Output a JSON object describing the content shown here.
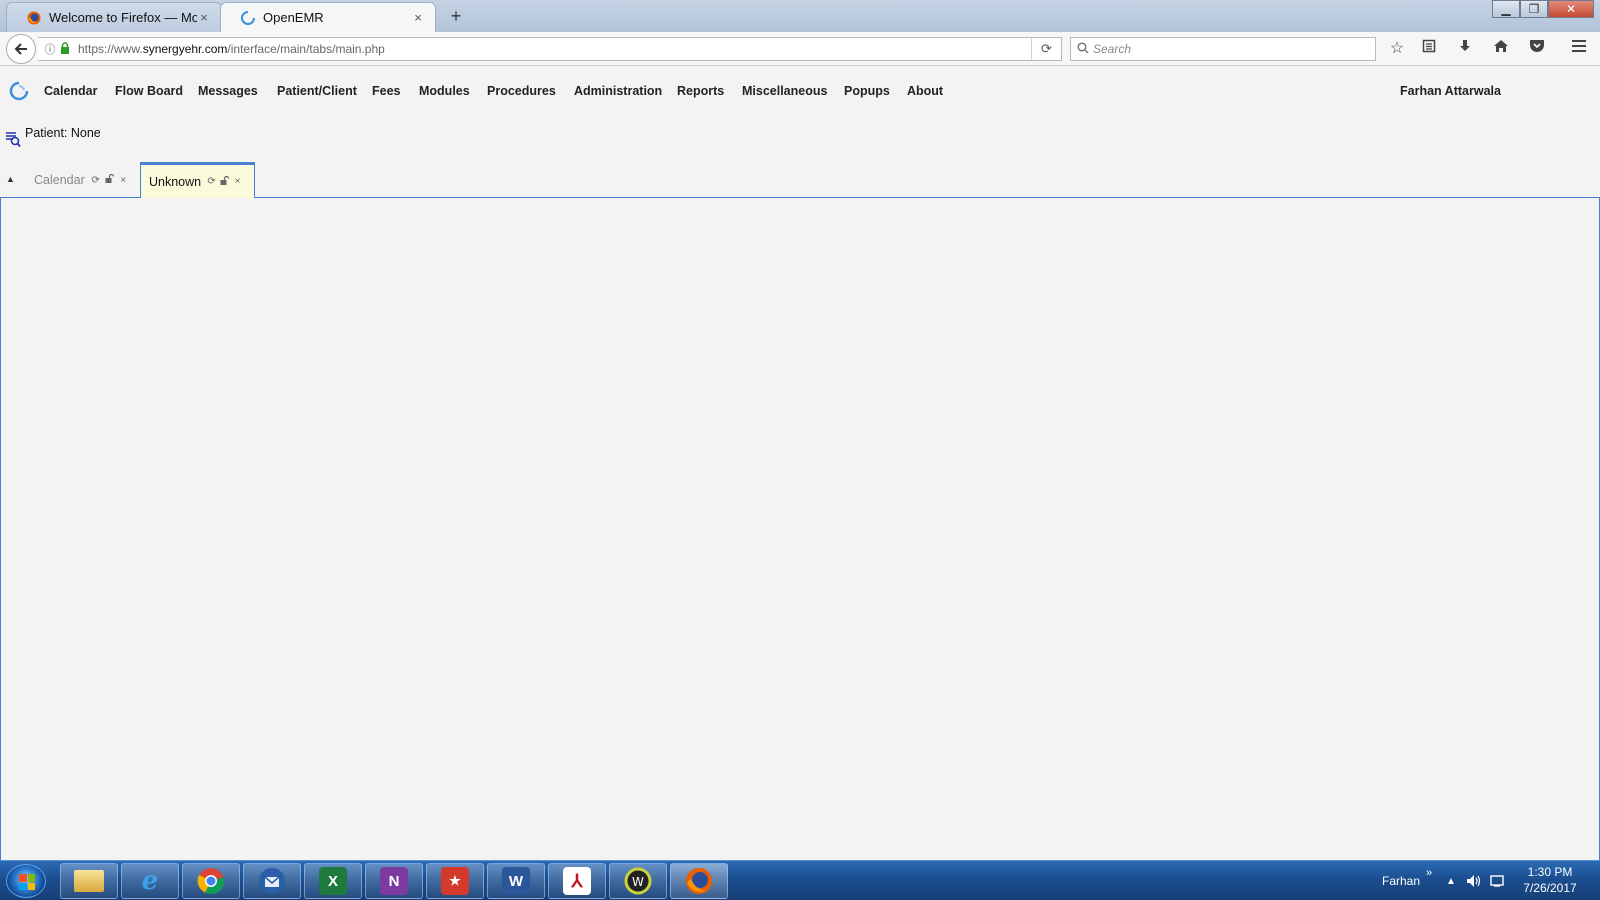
{
  "browser": {
    "tabs": [
      {
        "label": "Welcome to Firefox — Mozill",
        "active": false
      },
      {
        "label": "OpenEMR",
        "active": true
      }
    ],
    "new_tab": "+",
    "url": {
      "prefix": "https://www.",
      "host": "synergyehr.com",
      "path": "/interface/main/tabs/main.php"
    },
    "search_placeholder": "Search",
    "close_glyph": "×"
  },
  "app": {
    "menu": [
      "Calendar",
      "Flow Board",
      "Messages",
      "Patient/Client",
      "Fees",
      "Modules",
      "Procedures",
      "Administration",
      "Reports",
      "Miscellaneous",
      "Popups",
      "About"
    ],
    "user": "Farhan Attarwala",
    "patient": "Patient: None",
    "tabs": [
      {
        "label": "Calendar",
        "active": false
      },
      {
        "label": "Unknown",
        "active": true
      }
    ],
    "accent": "#4a7ed1"
  },
  "taskbar": {
    "apps": [
      "file-explorer",
      "internet-explorer",
      "chrome",
      "thunderbird",
      "excel",
      "onenote",
      "bookmark-app",
      "word",
      "acrobat",
      "webex",
      "firefox"
    ],
    "user": "Farhan",
    "overflow": "»",
    "time": "1:30 PM",
    "date": "7/26/2017"
  }
}
